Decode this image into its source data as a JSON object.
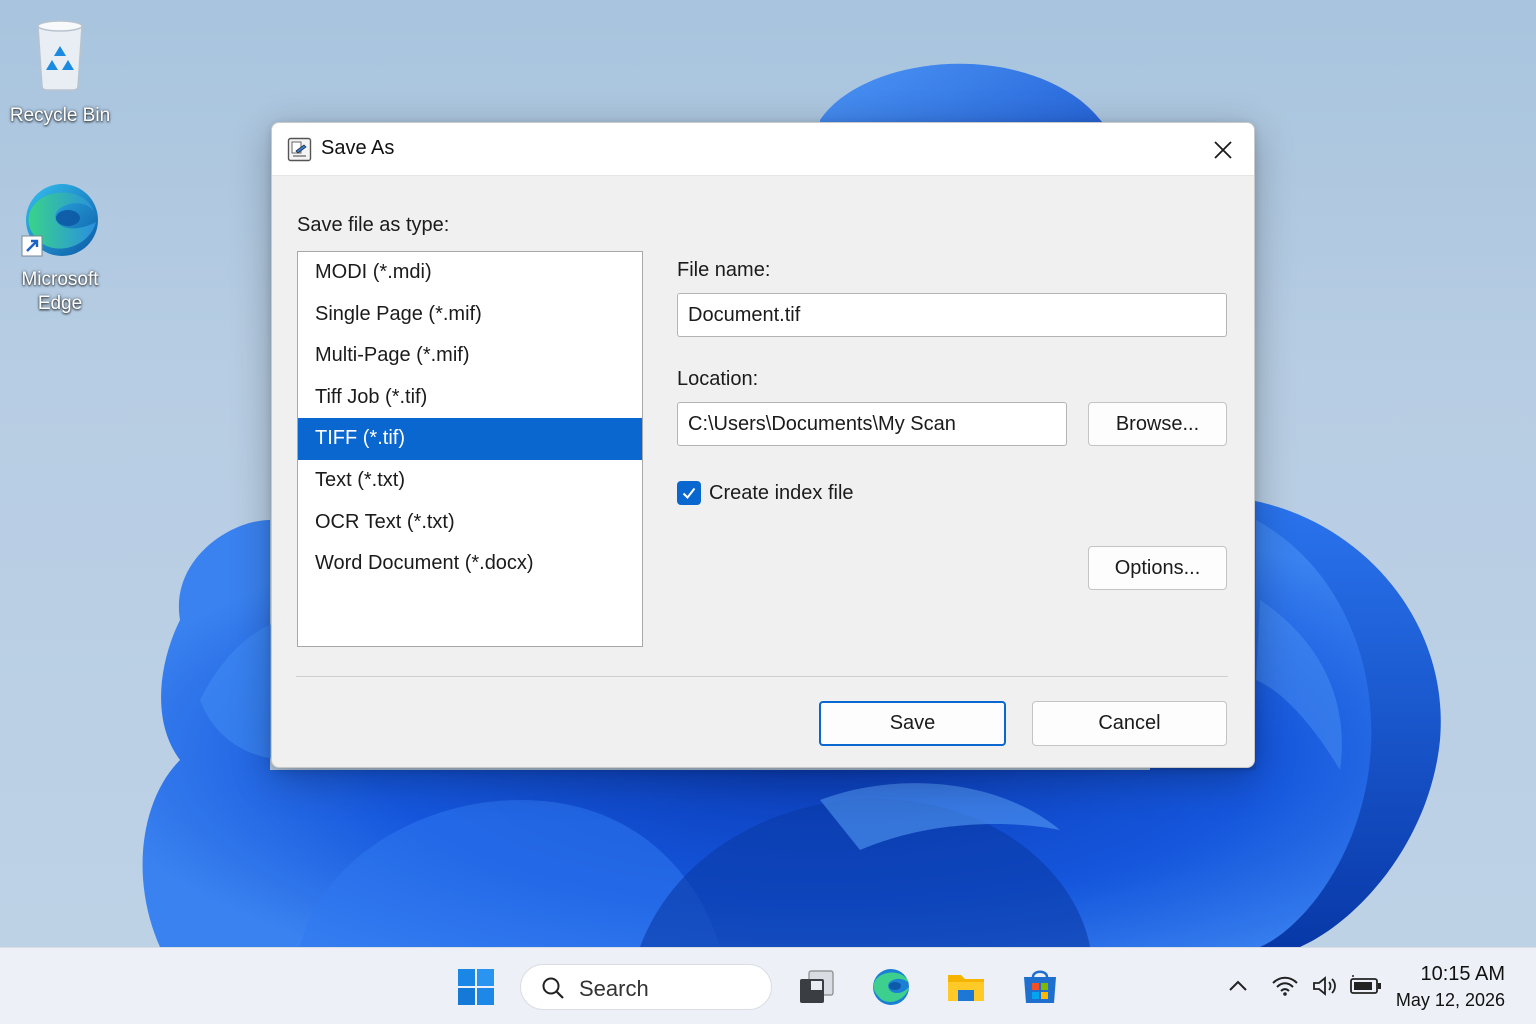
{
  "desktop": {
    "icons": [
      {
        "label": "Recycle Bin",
        "icon": "recycle-bin-icon"
      },
      {
        "label_line1": "Microsoft",
        "label_line2": "Edge",
        "icon": "edge-icon"
      }
    ]
  },
  "dialog": {
    "title": "Save As",
    "type_label": "Save file as type:",
    "types": [
      "MODI (*.mdi)",
      "Single Page (*.mif)",
      "Multi-Page (*.mif)",
      "Tiff Job (*.tif)",
      "TIFF (*.tif)",
      "Text (*.txt)",
      "OCR Text (*.txt)",
      "Word Document (*.docx)"
    ],
    "selected_type": "TIFF (*.tif)",
    "file_name_label": "File name:",
    "file_name_value": "Document.tif",
    "location_label": "Location:",
    "location_value": "C:\\Users\\Documents\\My Scan",
    "browse_label": "Browse...",
    "index_checkbox_label": "Create index file",
    "index_checkbox_checked": true,
    "options_label": "Options...",
    "save_label": "Save",
    "cancel_label": "Cancel"
  },
  "taskbar": {
    "search_placeholder": "Search",
    "apps": [
      "start-icon",
      "task-view-icon",
      "edge-icon",
      "file-explorer-icon",
      "store-icon"
    ],
    "tray": [
      "chevron-up-icon",
      "wifi-icon",
      "volume-icon",
      "battery-icon"
    ],
    "time": "10:15 AM",
    "date": "May 12, 2026"
  },
  "colors": {
    "accent": "#0a67d0",
    "wallpaper_bloom": "#1f5fe0"
  }
}
